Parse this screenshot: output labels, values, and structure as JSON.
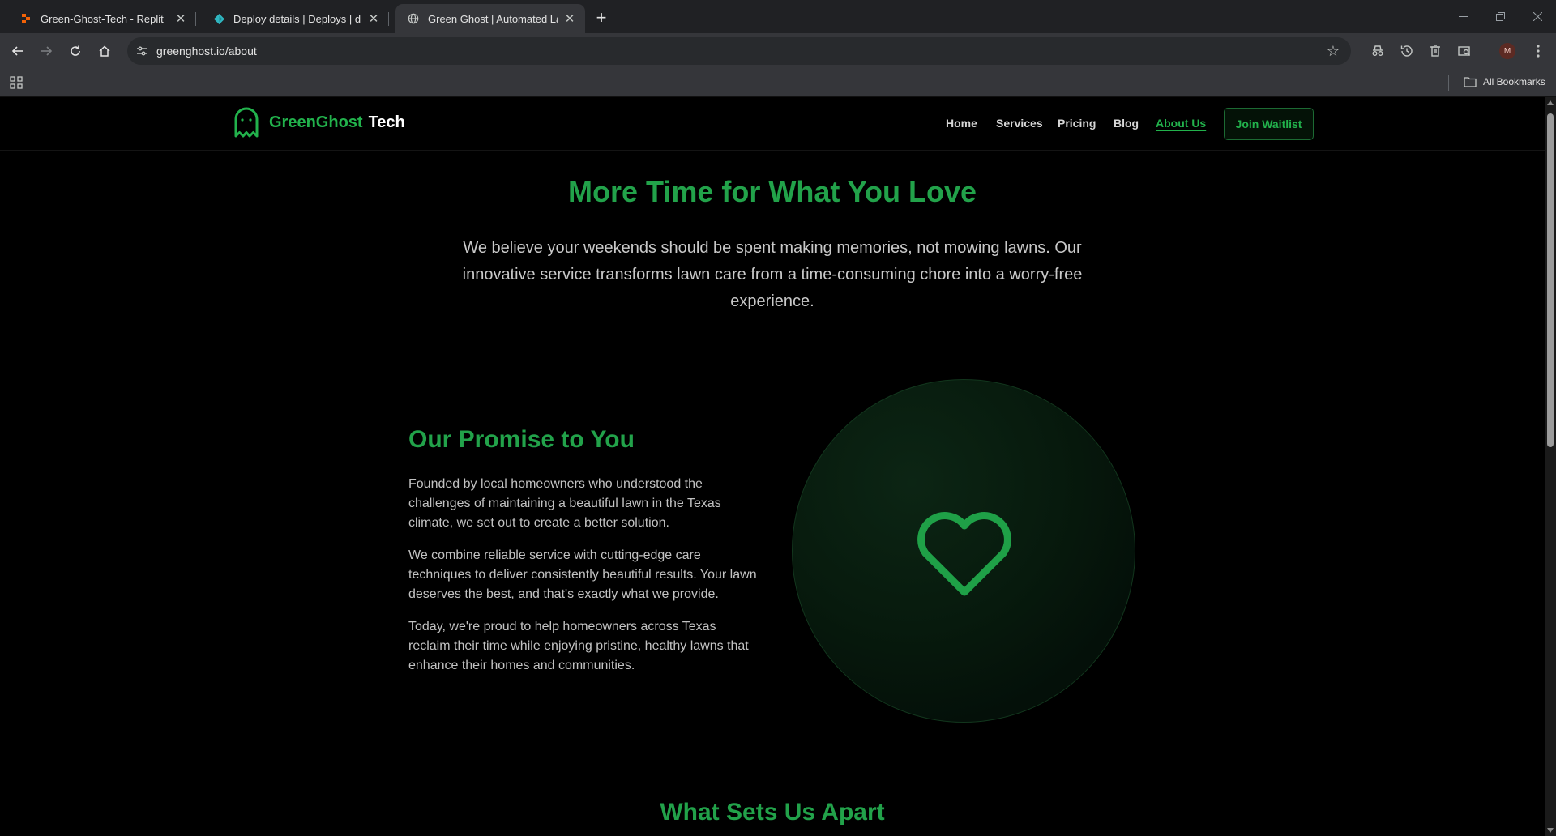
{
  "browser": {
    "tabs": [
      {
        "title": "Green-Ghost-Tech - Replit",
        "icon": "replit-icon"
      },
      {
        "title": "Deploy details | Deploys | darlin",
        "icon": "netlify-icon"
      },
      {
        "title": "Green Ghost | Automated Lawn",
        "icon": "globe-icon"
      }
    ],
    "url": "greenghost.io/about",
    "avatar_initial": "M",
    "bookmarks_label": "All Bookmarks"
  },
  "site": {
    "brand_green": "GreenGhost",
    "brand_white": "Tech",
    "nav": [
      "Home",
      "Services",
      "Pricing",
      "Blog",
      "About Us"
    ],
    "active_nav": "About Us",
    "cta": "Join Waitlist"
  },
  "hero": {
    "title": "More Time for What You Love",
    "text": "We believe your weekends should be spent making memories, not mowing lawns. Our innovative service transforms lawn care from a time-consuming chore into a worry-free experience."
  },
  "promise": {
    "title": "Our Promise to You",
    "paragraphs": [
      "Founded by local homeowners who understood the challenges of maintaining a beautiful lawn in the Texas climate, we set out to create a better solution.",
      "We combine reliable service with cutting-edge care techniques to deliver consistently beautiful results. Your lawn deserves the best, and that's exactly what we provide.",
      "Today, we're proud to help homeowners across Texas reclaim their time while enjoying pristine, healthy lawns that enhance their homes and communities."
    ],
    "illustration_icon": "heart-icon"
  },
  "apart": {
    "title": "What Sets Us Apart"
  },
  "colors": {
    "brand_green": "#22b24c",
    "heading_green": "#22a24a",
    "background": "#000000"
  }
}
